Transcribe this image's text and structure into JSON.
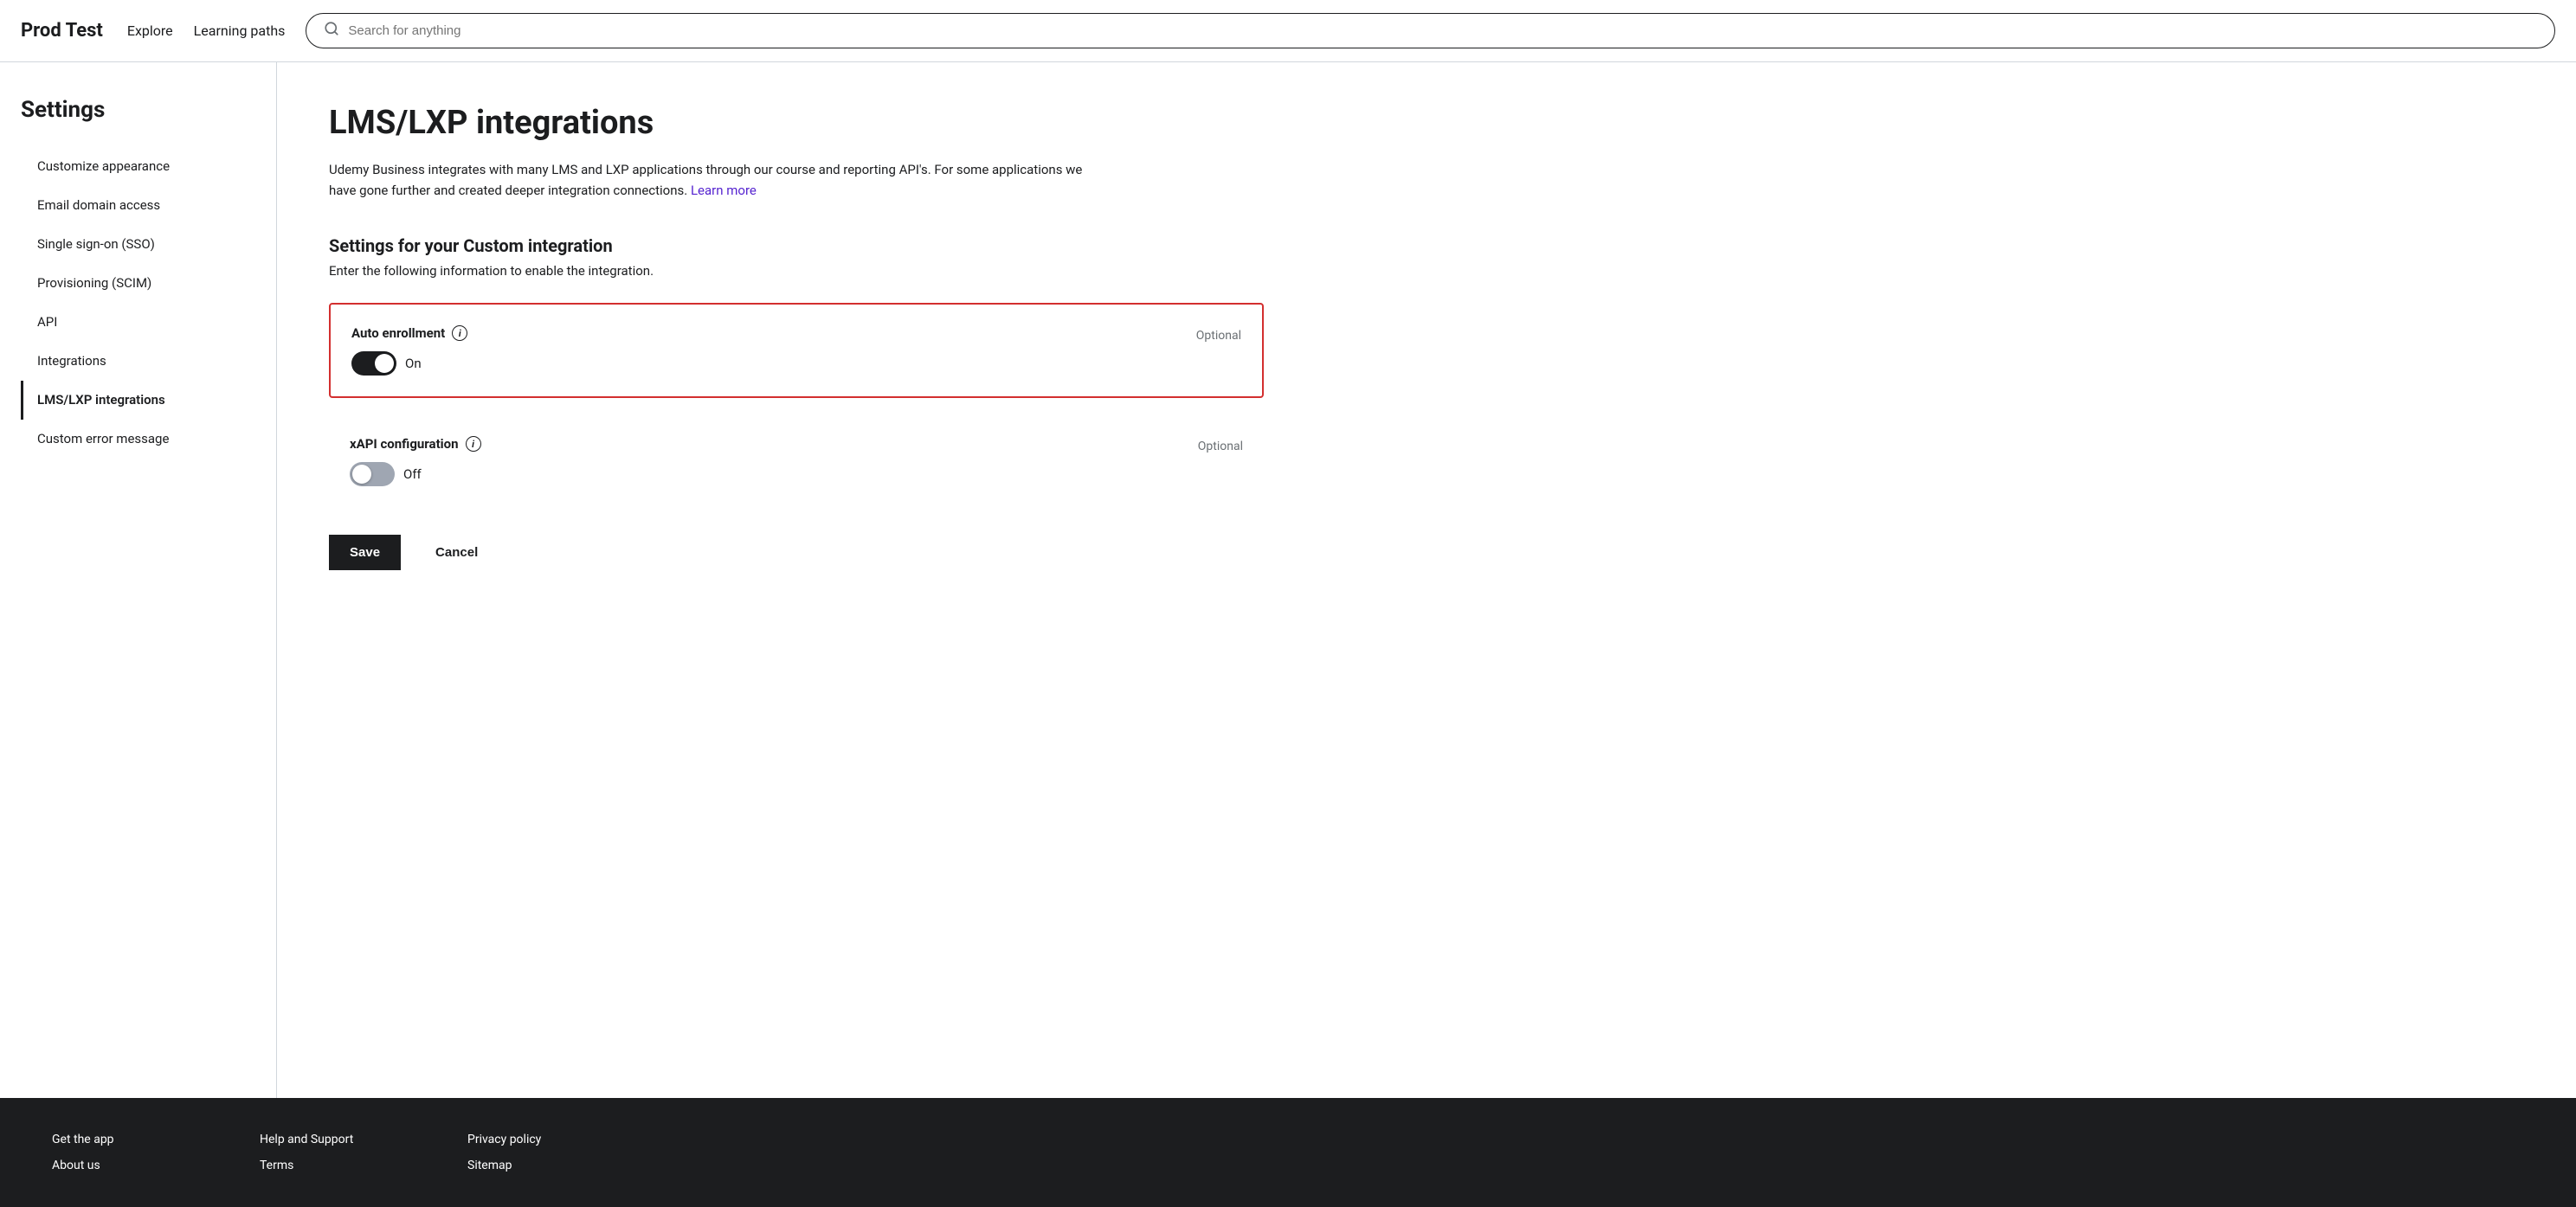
{
  "header": {
    "brand": "Prod Test",
    "nav": [
      {
        "label": "Explore",
        "id": "explore"
      },
      {
        "label": "Learning paths",
        "id": "learning-paths"
      }
    ],
    "search_placeholder": "Search for anything"
  },
  "sidebar": {
    "title": "Settings",
    "items": [
      {
        "label": "Customize appearance",
        "id": "customize-appearance",
        "active": false
      },
      {
        "label": "Email domain access",
        "id": "email-domain-access",
        "active": false
      },
      {
        "label": "Single sign-on (SSO)",
        "id": "sso",
        "active": false
      },
      {
        "label": "Provisioning (SCIM)",
        "id": "scim",
        "active": false
      },
      {
        "label": "API",
        "id": "api",
        "active": false
      },
      {
        "label": "Integrations",
        "id": "integrations",
        "active": false
      },
      {
        "label": "LMS/LXP integrations",
        "id": "lms-lxp",
        "active": true
      },
      {
        "label": "Custom error message",
        "id": "custom-error",
        "active": false
      }
    ]
  },
  "content": {
    "page_title": "LMS/LXP integrations",
    "description": "Udemy Business integrates with many LMS and LXP applications through our course and reporting API's. For some applications we have gone further and created deeper integration connections.",
    "learn_more_text": "Learn more",
    "section_title": "Settings for your Custom integration",
    "section_subtitle": "Enter the following information to enable the integration.",
    "settings": [
      {
        "id": "auto-enrollment",
        "label": "Auto enrollment",
        "optional_text": "Optional",
        "toggle_state": "on",
        "toggle_label_on": "On",
        "toggle_label_off": "Off",
        "highlighted": true
      },
      {
        "id": "xapi-configuration",
        "label": "xAPI configuration",
        "optional_text": "Optional",
        "toggle_state": "off",
        "toggle_label_on": "On",
        "toggle_label_off": "Off",
        "highlighted": false
      }
    ],
    "save_button": "Save",
    "cancel_button": "Cancel"
  },
  "footer": {
    "columns": [
      {
        "id": "col1",
        "links": [
          {
            "label": "Get the app",
            "id": "get-app"
          },
          {
            "label": "About us",
            "id": "about-us"
          }
        ]
      },
      {
        "id": "col2",
        "links": [
          {
            "label": "Help and Support",
            "id": "help-support"
          },
          {
            "label": "Terms",
            "id": "terms"
          }
        ]
      },
      {
        "id": "col3",
        "links": [
          {
            "label": "Privacy policy",
            "id": "privacy-policy"
          },
          {
            "label": "Sitemap",
            "id": "sitemap"
          }
        ]
      }
    ]
  }
}
